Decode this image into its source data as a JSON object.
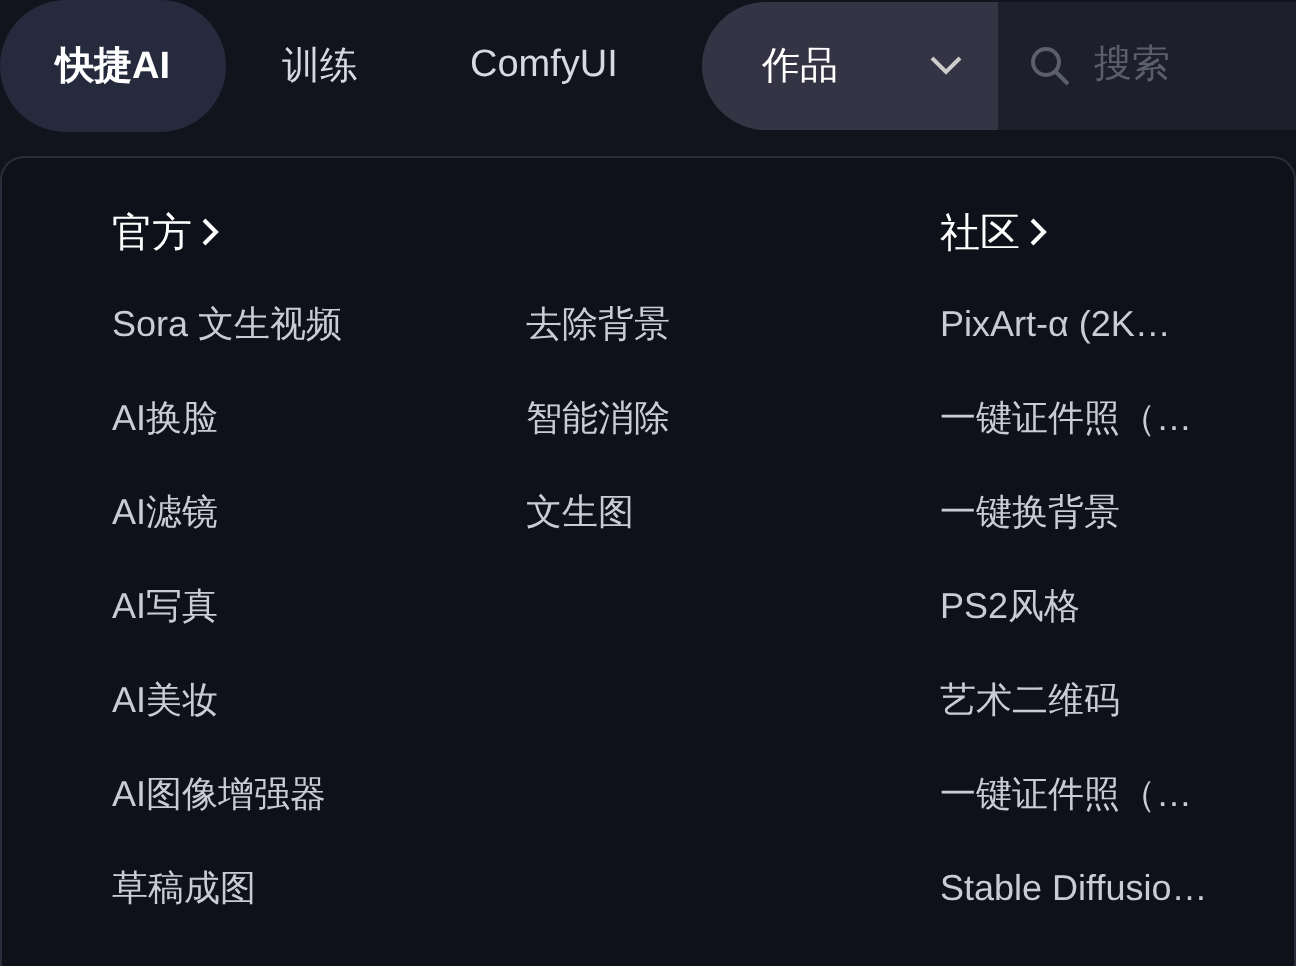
{
  "nav": {
    "tabs": [
      {
        "label": "快捷AI",
        "selected": true
      },
      {
        "label": "训练",
        "selected": false
      },
      {
        "label": "ComfyUI",
        "selected": false
      }
    ],
    "dropdown": {
      "label": "作品"
    },
    "search": {
      "placeholder": "搜索"
    }
  },
  "menu": {
    "sections": [
      {
        "title": "官方",
        "columns": [
          [
            "Sora 文生视频",
            "AI换脸",
            "AI滤镜",
            "AI写真",
            "AI美妆",
            "AI图像增强器",
            "草稿成图"
          ],
          [
            "去除背景",
            "智能消除",
            "文生图"
          ]
        ]
      },
      {
        "title": "社区",
        "columns": [
          [
            "PixArt-α (2K…",
            "一键证件照（…",
            "一键换背景",
            "PS2风格",
            "艺术二维码",
            "一键证件照（…",
            "Stable Diffusio…"
          ]
        ]
      }
    ]
  }
}
